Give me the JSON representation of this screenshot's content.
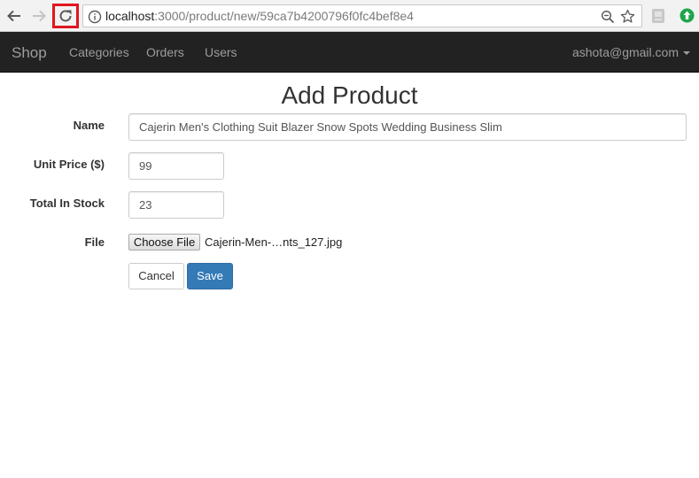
{
  "browser": {
    "url_host": "localhost",
    "url_rest": ":3000/product/new/59ca7b4200796f0fc4bef8e4",
    "icons": {
      "back": "arrow-left-icon",
      "forward": "arrow-right-icon",
      "reload": "reload-icon",
      "info": "info-icon",
      "zoom": "zoom-icon",
      "bookmark": "star-icon",
      "extension_1": "extension-icon",
      "extension_2": "upload-arrow-icon"
    },
    "colors": {
      "reload_highlight": "#e0161f",
      "extension_green": "#1fa54a"
    }
  },
  "navbar": {
    "brand": "Shop",
    "links": [
      "Categories",
      "Orders",
      "Users"
    ],
    "user": "ashota@gmail.com",
    "colors": {
      "background": "#222222",
      "text": "#9d9d9d"
    }
  },
  "form": {
    "title": "Add Product",
    "name_label": "Name",
    "name_value": "Cajerin Men's Clothing Suit Blazer Snow Spots Wedding Business Slim",
    "price_label": "Unit Price ($)",
    "price_value": "99",
    "stock_label": "Total In Stock",
    "stock_value": "23",
    "file_label": "File",
    "file_button": "Choose File",
    "file_name": "Cajerin-Men-…nts_127.jpg",
    "cancel_label": "Cancel",
    "save_label": "Save",
    "colors": {
      "primary": "#337ab7"
    }
  }
}
